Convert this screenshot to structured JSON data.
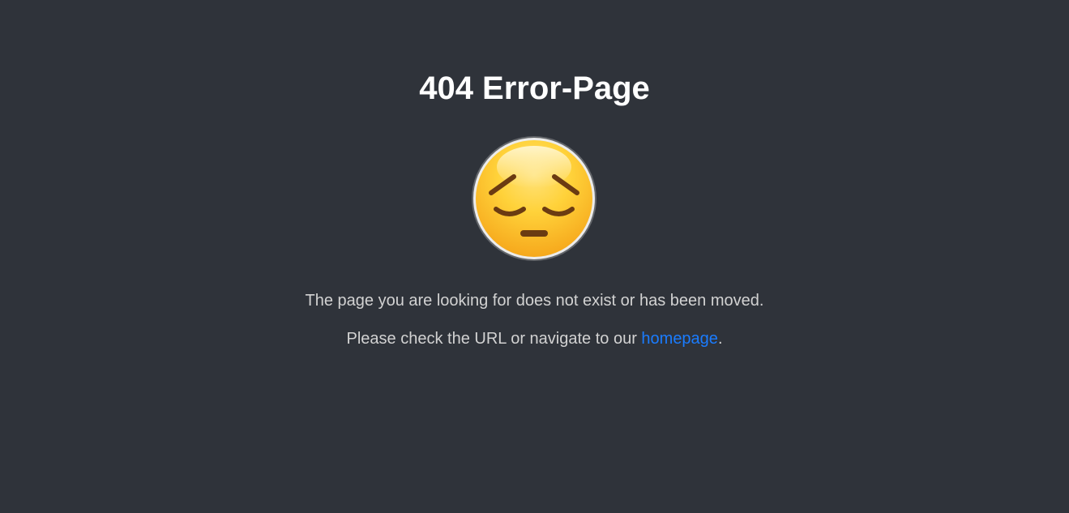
{
  "page": {
    "title": "404 Error-Page",
    "icon": "pensive-face-icon",
    "message_line1": "The page you are looking for does not exist or has been moved.",
    "message_line2_before": "Please check the URL or navigate to our ",
    "homepage_link": "homepage",
    "message_line2_after": "."
  },
  "colors": {
    "background": "#2f333a",
    "title": "#ffffff",
    "text": "#d2d2d2",
    "link": "#1a7cff"
  }
}
